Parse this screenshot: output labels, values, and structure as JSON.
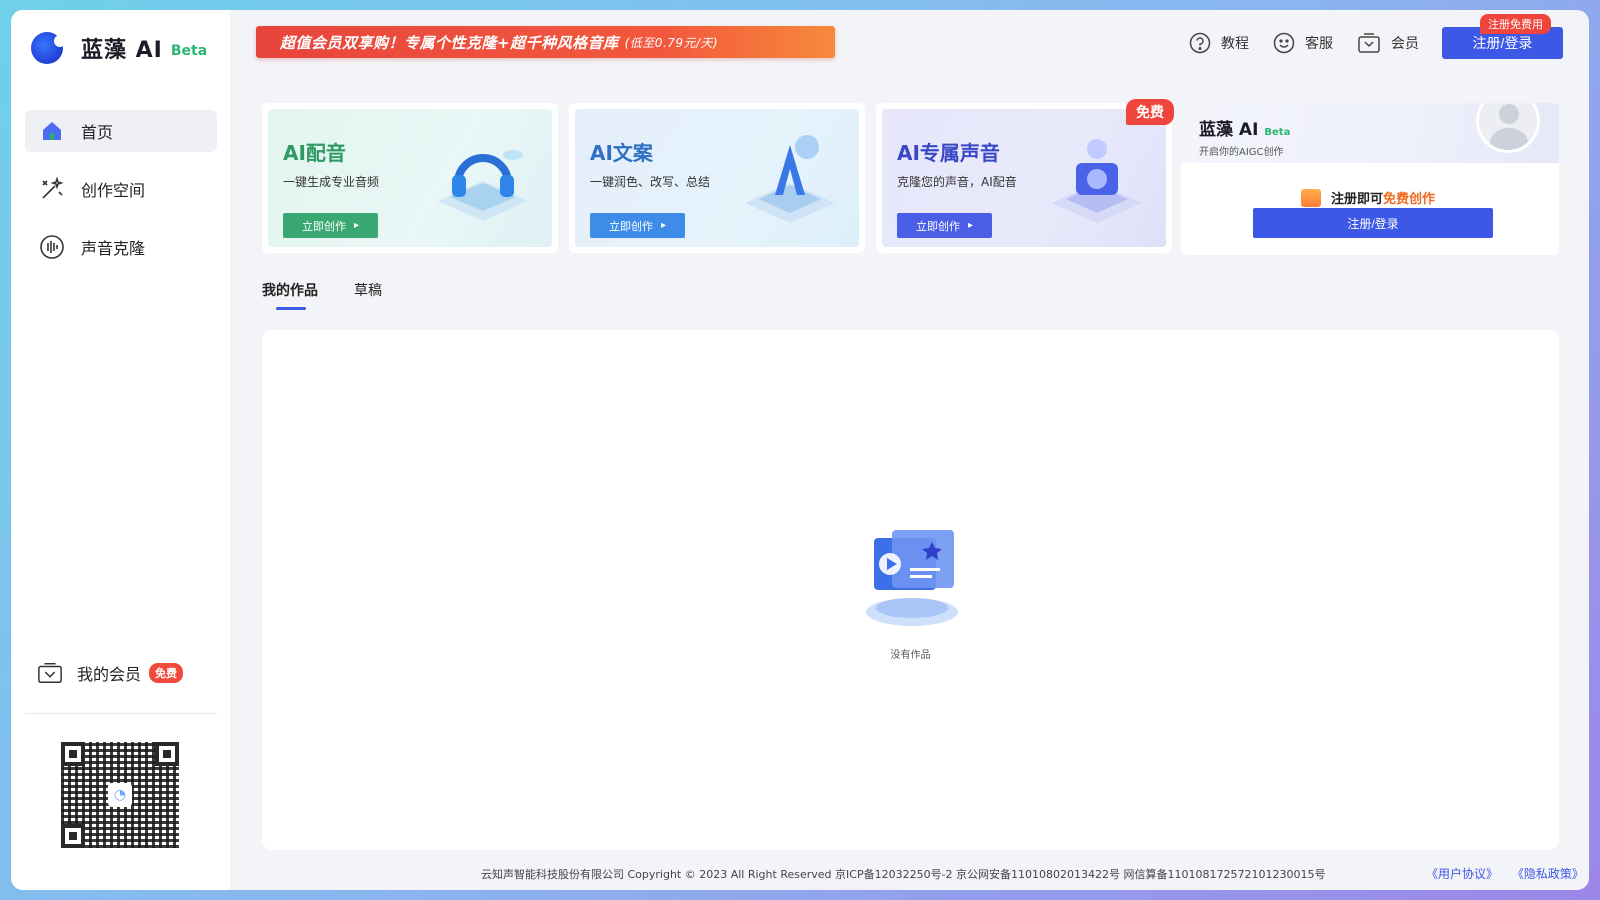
{
  "app": {
    "name": "蓝藻 AI",
    "beta": "Beta"
  },
  "sidebar": {
    "items": [
      {
        "label": "首页",
        "icon": "home-icon"
      },
      {
        "label": "创作空间",
        "icon": "magic-wand-icon"
      },
      {
        "label": "声音克隆",
        "icon": "voice-wave-icon"
      }
    ],
    "member": {
      "label": "我的会员",
      "tag": "免费"
    }
  },
  "header": {
    "banner": "超值会员双享购！专属个性克隆+超千种风格音库",
    "banner_note": "(低至0.79元/天)",
    "links": [
      {
        "label": "教程",
        "icon": "help-circle-icon"
      },
      {
        "label": "客服",
        "icon": "smile-icon"
      },
      {
        "label": "会员",
        "icon": "member-icon"
      }
    ],
    "login_button": "注册/登录",
    "login_badge": "注册免费用"
  },
  "cards": [
    {
      "title": "AI配音",
      "subtitle": "一键生成专业音频",
      "button": "立即创作",
      "color": "#3aa873"
    },
    {
      "title": "AI文案",
      "subtitle": "一键润色、改写、总结",
      "button": "立即创作",
      "color": "#3e8ce8"
    },
    {
      "title": "AI专属声音",
      "subtitle": "克隆您的声音，AI配音",
      "button": "立即创作",
      "color": "#4b5ee8",
      "badge": "免费"
    }
  ],
  "login_card": {
    "title": "蓝藻 AI",
    "beta": "Beta",
    "subtitle": "开启你的AIGC创作",
    "promo_prefix": "注册即可",
    "promo_highlight": "免费创作",
    "button": "注册/登录"
  },
  "tabs": [
    {
      "label": "我的作品",
      "active": true
    },
    {
      "label": "草稿",
      "active": false
    }
  ],
  "content": {
    "empty_text": "没有作品"
  },
  "footer": {
    "text": "云知声智能科技股份有限公司 Copyright © 2023 All Right Reserved 京ICP备12032250号-2 京公网安备11010802013422号 网信算备110108172572101230015号",
    "links": [
      "《用户协议》",
      "《隐私政策》"
    ]
  },
  "colors": {
    "primary": "#3d57e6",
    "accent_red": "#f0453d",
    "beta_green": "#2bb673"
  }
}
